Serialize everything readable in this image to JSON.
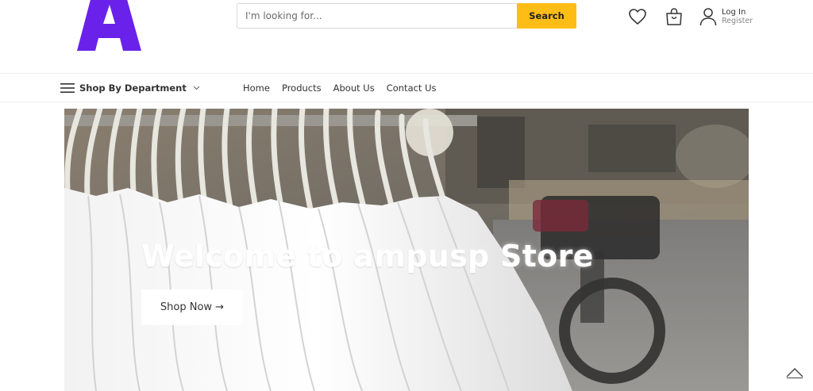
{
  "header": {
    "logo_letter": "A",
    "search": {
      "placeholder": "I'm looking for...",
      "value": "",
      "button_label": "Search"
    },
    "icons": {
      "wishlist": "heart-icon",
      "cart": "shopping-bag-icon",
      "account": "user-icon"
    },
    "account": {
      "login_label": "Log In",
      "register_label": "Register"
    }
  },
  "navbar": {
    "department_label": "Shop By Department",
    "links": [
      "Home",
      "Products",
      "About Us",
      "Contact Us"
    ]
  },
  "hero": {
    "title": "Welcome to ampusp Store",
    "button_label": "Shop Now →"
  },
  "colors": {
    "accent": "#febd16",
    "logo": "#6a22ea"
  }
}
